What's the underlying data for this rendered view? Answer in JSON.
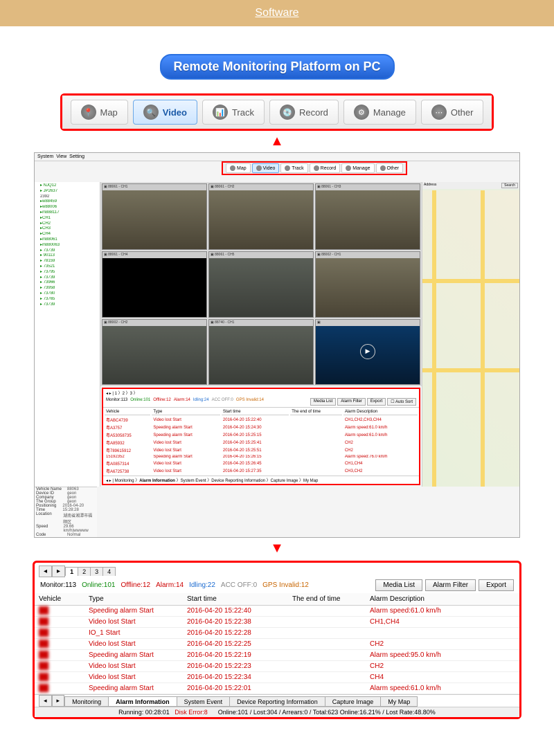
{
  "software_label": "Software",
  "platform_title": "Remote Monitoring Platform on PC",
  "toolbar": {
    "items": [
      {
        "label": "Map",
        "icon": "📍"
      },
      {
        "label": "Video",
        "icon": "🔍",
        "active": true
      },
      {
        "label": "Track",
        "icon": "📊"
      },
      {
        "label": "Record",
        "icon": "💿"
      },
      {
        "label": "Manage",
        "icon": "⚙"
      },
      {
        "label": "Other",
        "icon": "⋯"
      }
    ]
  },
  "tree": {
    "items": [
      "▸ NJQ12",
      "▸ JP2637",
      "  2392",
      "▸w88459",
      "▸w88006",
      "▸m888117",
      "  ▸CH1",
      "  ▸CH2",
      "  ▸CH3",
      "  ▸CH4",
      "▸m88061",
      "▸m880063",
      "▸ 73739",
      "▸ 90113",
      "▸ 78159",
      "▸ 73521",
      "▸ 73795",
      "▸ 73739",
      "▸ 73966",
      "▸ 73958",
      "▸ 73780",
      "▸ 73765",
      "▸ 73739"
    ]
  },
  "video_ch": [
    "88061 - CH1",
    "88061 - CH2",
    "88061 - CH3",
    "88061 - CH4",
    "88061 - CH5",
    "88002 - CH1",
    "88002 - CH2",
    "88740 - CH1"
  ],
  "info": {
    "rows": [
      {
        "k": "Vehicle Name",
        "v": "88063"
      },
      {
        "k": "Device ID",
        "v": "geon"
      },
      {
        "k": "Company",
        "v": "geon"
      },
      {
        "k": "The Group",
        "v": "geon"
      },
      {
        "k": "Positioning Time",
        "v": "2016-04-20 15:28:28"
      },
      {
        "k": "Location",
        "v": "湖南省湘潭市福顺区"
      },
      {
        "k": "Speed",
        "v": "29.66 km/h|wwwww"
      },
      {
        "k": "Code",
        "v": "Normal"
      }
    ]
  },
  "mini_status": {
    "monitor": "Monitor:113",
    "online": "Online:101",
    "offline": "Offline:12",
    "alarm": "Alarm:14",
    "idling": "Idling:24",
    "acc": "ACC OFF:0",
    "gps": "GPS Invalid:14"
  },
  "mini_btns": {
    "media": "Media List",
    "filter": "Alarm Filter",
    "export": "Export",
    "auto": "Auto Sort"
  },
  "mini_rows": [
    {
      "v": "粤ABC4739",
      "t": "Video lost Start",
      "s": "2016-04-20 15:22:40",
      "e": "",
      "d": "CH1,CH2,CH3,CH4"
    },
    {
      "v": "粤A3757",
      "t": "Speeding alarm Start",
      "s": "2016-04-20 15:24:30",
      "e": "",
      "d": "Alarm speed:61.0 km/h"
    },
    {
      "v": "粤A53058735",
      "t": "Speeding alarm Start",
      "s": "2016-04-20 15:25:15",
      "e": "",
      "d": "Alarm speed:61.0 km/h"
    },
    {
      "v": "粤A85932",
      "t": "Video lost Start",
      "s": "2016-04-20 15:25:41",
      "e": "",
      "d": "CH2"
    },
    {
      "v": "粤789615912",
      "t": "Video lost Start",
      "s": "2016-04-20 15:25:51",
      "e": "",
      "d": "CH2"
    },
    {
      "v": "15192352",
      "t": "Speeding alarm Start",
      "s": "2016-04-20 15:26:15",
      "e": "",
      "d": "Alarm speed:76.0 km/h"
    },
    {
      "v": "粤A0857314",
      "t": "Video lost Start",
      "s": "2016-04-20 15:26:45",
      "e": "",
      "d": "CH1,CH4"
    },
    {
      "v": "粤A6725738",
      "t": "Video lost Start",
      "s": "2016-04-20 15:27:35",
      "e": "",
      "d": "CH3,CH2"
    }
  ],
  "big": {
    "page_tabs": [
      "1",
      "2",
      "3",
      "4"
    ],
    "status": {
      "monitor": "Monitor:113",
      "online": "Online:101",
      "offline": "Offline:12",
      "alarm": "Alarm:14",
      "idling": "Idling:22",
      "acc": "ACC OFF:0",
      "gps": "GPS Invalid:12"
    },
    "btns": {
      "media": "Media List",
      "filter": "Alarm Filter",
      "export": "Export"
    },
    "cols": {
      "vehicle": "Vehicle",
      "type": "Type",
      "start": "Start time",
      "end": "The end of time",
      "desc": "Alarm Description"
    },
    "rows": [
      {
        "veh": "██",
        "type": "Speeding alarm Start",
        "start": "2016-04-20 15:22:40",
        "end": "",
        "desc": "Alarm speed:61.0 km/h"
      },
      {
        "veh": "██",
        "type": "Video lost Start",
        "start": "2016-04-20 15:22:38",
        "end": "",
        "desc": "CH1,CH4"
      },
      {
        "veh": "██",
        "type": "IO_1 Start",
        "start": "2016-04-20 15:22:28",
        "end": "",
        "desc": ""
      },
      {
        "veh": "██",
        "type": "Video lost Start",
        "start": "2016-04-20 15:22:25",
        "end": "",
        "desc": "CH2"
      },
      {
        "veh": "██",
        "type": "Speeding alarm Start",
        "start": "2016-04-20 15:22:19",
        "end": "",
        "desc": "Alarm speed:95.0 km/h"
      },
      {
        "veh": "██",
        "type": "Video lost Start",
        "start": "2016-04-20 15:22:23",
        "end": "",
        "desc": "CH2"
      },
      {
        "veh": "██",
        "type": "Video lost Start",
        "start": "2016-04-20 15:22:34",
        "end": "",
        "desc": "CH4"
      },
      {
        "veh": "██",
        "type": "Speeding alarm Start",
        "start": "2016-04-20 15:22:01",
        "end": "",
        "desc": "Alarm speed:61.0 km/h"
      }
    ],
    "bottom_tabs": [
      "Monitoring",
      "Alarm Information",
      "System Event",
      "Device Reporting Information",
      "Capture Image",
      "My Map"
    ],
    "footer": {
      "running": "Running: 00:28:01",
      "disk": "Disk Error:8",
      "stats": "Online:101 / Lost:304 / Arrears:0 / Total:623   Online:16.21% / Lost Rate:48.80%"
    }
  }
}
